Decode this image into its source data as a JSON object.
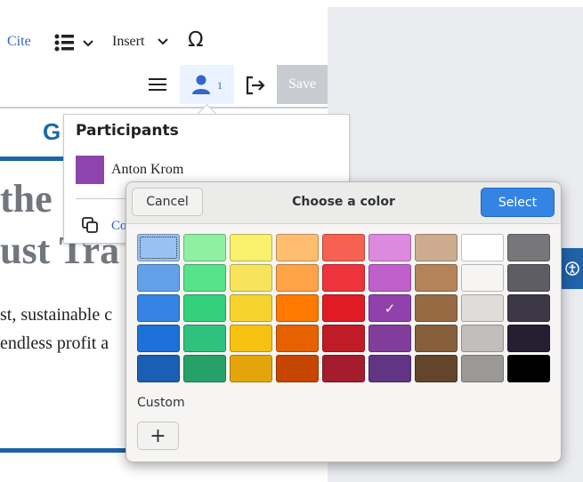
{
  "toolbar": {
    "cite_label": "Cite",
    "insert_label": "Insert",
    "special_char_label": "Ω",
    "participants_count": "1",
    "save_label": "Save"
  },
  "article": {
    "logo_letter": "G",
    "heading_line1": "the",
    "heading_line2": "ust Tra",
    "para_line1": "st, sustainable c",
    "para_line2": "endless profit a"
  },
  "participants_popup": {
    "title": "Participants",
    "participant_name": "Anton Krom",
    "participant_color": "#8e44ad",
    "copy_link_label": "Co"
  },
  "color_dialog": {
    "title": "Choose a color",
    "cancel_label": "Cancel",
    "select_label": "Select",
    "custom_label": "Custom",
    "add_label": "+",
    "selected_color": "#9141ac",
    "colors": [
      [
        "#99c1f1",
        "#8ff0a4",
        "#f9f06b",
        "#ffbe6f",
        "#f66151",
        "#dc8add",
        "#cdab8f",
        "#ffffff",
        "#77767b"
      ],
      [
        "#62a0ea",
        "#57e389",
        "#f8e45c",
        "#ffa348",
        "#ed333b",
        "#c061cb",
        "#b5835a",
        "#f6f5f4",
        "#5e5c64"
      ],
      [
        "#3584e4",
        "#33d17a",
        "#f6d32d",
        "#ff7800",
        "#e01b24",
        "#9141ac",
        "#986a44",
        "#deddda",
        "#3d3846"
      ],
      [
        "#1c71d8",
        "#2ec27e",
        "#f5c211",
        "#e66100",
        "#c01c28",
        "#813d9c",
        "#865e3c",
        "#c0bfbc",
        "#241f31"
      ],
      [
        "#1a5fb4",
        "#26a269",
        "#e5a50a",
        "#c64600",
        "#a51d2d",
        "#613583",
        "#63452c",
        "#9a9996",
        "#000000"
      ]
    ]
  }
}
